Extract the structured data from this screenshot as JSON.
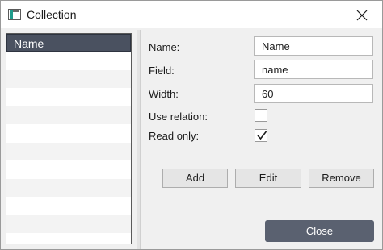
{
  "window": {
    "title": "Collection",
    "icons": {
      "app": "app-window-icon",
      "close": "close-icon"
    }
  },
  "list": {
    "header": "Name",
    "items": []
  },
  "form": {
    "name": {
      "label": "Name:",
      "value": "Name"
    },
    "field": {
      "label": "Field:",
      "value": "name"
    },
    "width": {
      "label": "Width:",
      "value": "60"
    },
    "use_relation": {
      "label": "Use relation:",
      "checked": false
    },
    "read_only": {
      "label": "Read only:",
      "checked": true
    }
  },
  "actions": {
    "add": "Add",
    "edit": "Edit",
    "remove": "Remove"
  },
  "footer": {
    "close": "Close"
  },
  "colors": {
    "header_bg": "#4a5160",
    "close_button_bg": "#5a6170",
    "window_bg": "#f0f0f0",
    "icon_accent": "#1f9c8c"
  }
}
